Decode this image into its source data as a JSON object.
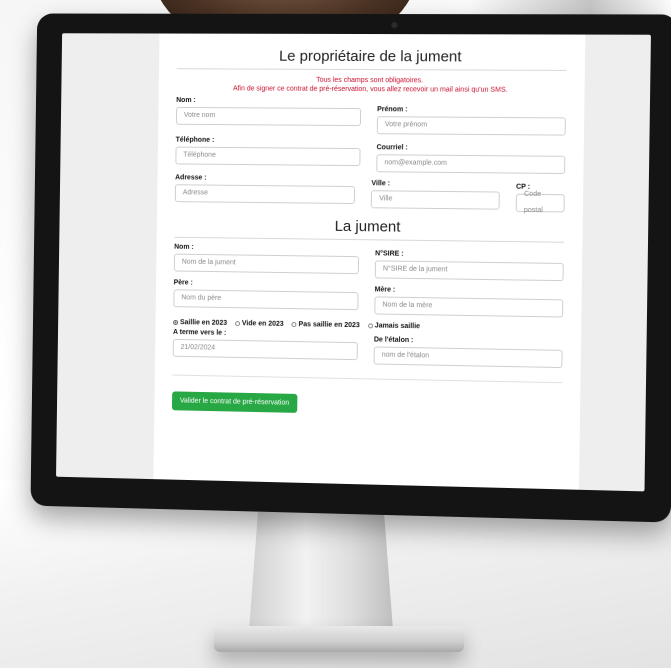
{
  "owner_section": {
    "title": "Le propriétaire de la jument",
    "notice_line1": "Tous les champs sont obligatoires.",
    "notice_line2": "Afin de signer ce contrat de pré-réservation, vous allez recevoir un mail ainsi qu'un SMS.",
    "fields": {
      "nom_label": "Nom :",
      "nom_placeholder": "Votre nom",
      "prenom_label": "Prénom :",
      "prenom_placeholder": "Votre prénom",
      "telephone_label": "Téléphone :",
      "telephone_placeholder": "Téléphone",
      "courriel_label": "Courriel :",
      "courriel_placeholder": "nom@example.com",
      "adresse_label": "Adresse :",
      "adresse_placeholder": "Adresse",
      "ville_label": "Ville :",
      "ville_placeholder": "Ville",
      "cp_label": "CP :",
      "cp_placeholder": "Code postal"
    }
  },
  "mare_section": {
    "title": "La jument",
    "fields": {
      "nom_label": "Nom :",
      "nom_placeholder": "Nom de la jument",
      "sire_label": "N°SIRE :",
      "sire_placeholder": "N°SIRE de la jument",
      "pere_label": "Père :",
      "pere_placeholder": "Nom du père",
      "mere_label": "Mère :",
      "mere_placeholder": "Nom de la mère"
    },
    "status_options": [
      {
        "label": "Saillie en 2023",
        "selected": true
      },
      {
        "label": "Vide en 2023",
        "selected": false
      },
      {
        "label": "Pas saillie en 2023",
        "selected": false
      },
      {
        "label": "Jamais saillie",
        "selected": false
      }
    ],
    "term_label": "A terme vers le :",
    "term_value": "21/02/2024",
    "etalon_label": "De l'étalon :",
    "etalon_placeholder": "nom de l'étalon"
  },
  "submit_label": "Valider le contrat de pré-réservation",
  "colors": {
    "notice": "#c8102e",
    "submit": "#28a745"
  }
}
